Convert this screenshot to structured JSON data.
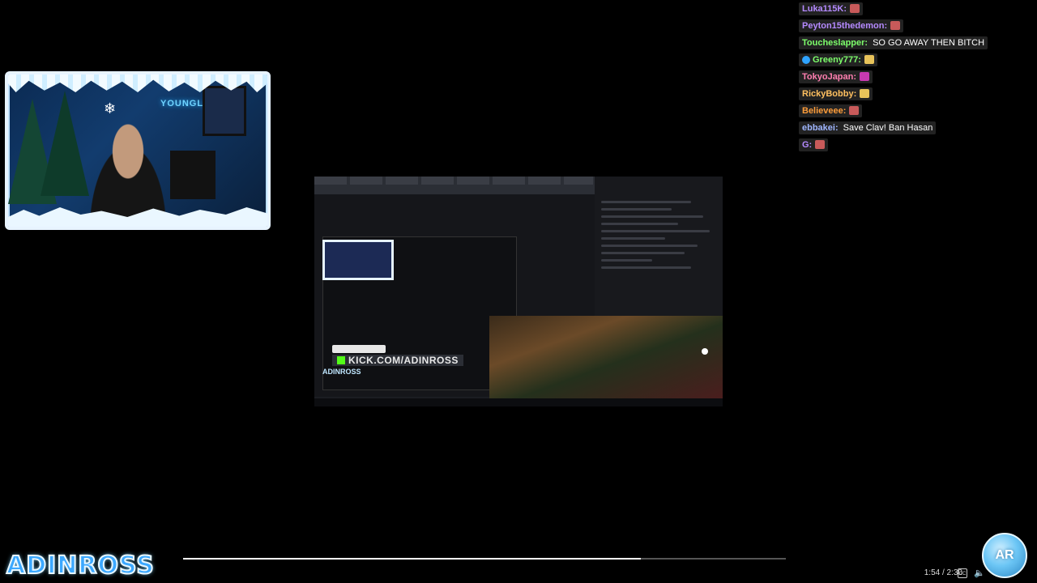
{
  "chat": {
    "messages": [
      {
        "name": "Luka115K:",
        "name_color": "#b58aff",
        "text": "",
        "emote_color": "#c85a5a"
      },
      {
        "name": "Peyton15thedemon:",
        "name_color": "#b58aff",
        "text": "",
        "emote_color": "#c85a5a"
      },
      {
        "name": "Toucheslapper:",
        "name_color": "#7dff6b",
        "text": "SO GO AWAY THEN BITCH",
        "emote_color": ""
      },
      {
        "name": "Greeny777:",
        "name_color": "#7dff6b",
        "text": "",
        "emote_color": "#e8c35a",
        "badge_color": "#2fa3ff"
      },
      {
        "name": "TokyoJapan:",
        "name_color": "#ff7fb0",
        "text": "",
        "emote_color": "#c83ab0"
      },
      {
        "name": "RickyBobby:",
        "name_color": "#ffc060",
        "text": "",
        "emote_color": "#e8c35a"
      },
      {
        "name": "Believeee:",
        "name_color": "#ff9d3a",
        "text": "",
        "emote_color": "#c85a5a"
      },
      {
        "name": "ebbakei:",
        "name_color": "#9fb6ff",
        "text": "Save Clav! Ban Hasan",
        "emote_color": ""
      },
      {
        "name": "G:",
        "name_color": "#b58aff",
        "text": "",
        "emote_color": "#c85a5a"
      }
    ]
  },
  "share": {
    "kick_url": "KICK.COM/ADINROSS",
    "small_channel": "ADINROSS"
  },
  "webcam": {
    "neon_sign": "YOUNGLA"
  },
  "player": {
    "logo_text": "ADINROSS",
    "time": "1:54 / 2:30",
    "progress": 0.76,
    "cc_label": "CC",
    "volume_glyph": "🔈",
    "globe_text": "AR"
  },
  "colors": {
    "background": "#000000",
    "kick_green": "#53fc18",
    "brand_blue": "#3ba8ff"
  }
}
